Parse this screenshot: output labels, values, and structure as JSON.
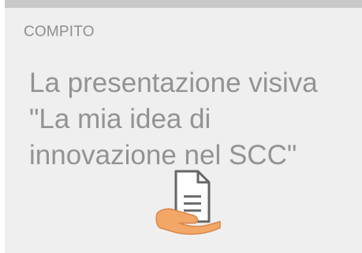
{
  "card": {
    "type_label": "COMPITO",
    "title": "La presentazione visiva \"La mia idea di innovazione nel SCC\"",
    "icon": "assignment-hand-document-icon"
  },
  "colors": {
    "card_background": "#efefef",
    "top_border": "#c9c9c9",
    "label_text": "#8f8f8f",
    "title_text": "#939393",
    "hand": "#f2a766",
    "document_stroke": "#666666"
  }
}
